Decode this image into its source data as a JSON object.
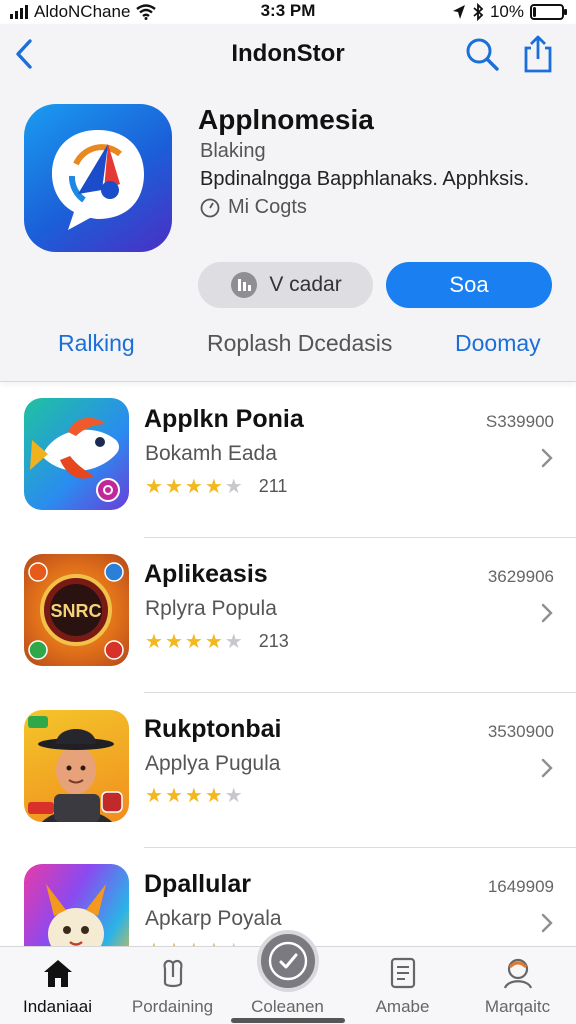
{
  "status_bar": {
    "carrier": "AldoNChane",
    "time": "3:3 PM",
    "battery": "10%",
    "battery_fraction": 0.1
  },
  "nav": {
    "title": "IndonStor"
  },
  "app": {
    "name": "Applnomesia",
    "category": "Blaking",
    "description": "Bpdinalngga Bapphlanaks.  Apphksis.",
    "rating_text": "Mi Cogts",
    "secondary_button": "V cadar",
    "primary_button": "Soa"
  },
  "tabs": [
    "Ralking",
    "Roplash Dcedasis",
    "Doomay"
  ],
  "list": [
    {
      "title": "Applkn Ponia",
      "subtitle": "Bokamh Eada",
      "size": "S339900",
      "rating": 4.5,
      "count": "211"
    },
    {
      "title": "Aplikeasis",
      "subtitle": "Rplyra Popula",
      "size": "3629906",
      "rating": 4.5,
      "count": "213"
    },
    {
      "title": "Rukptonbai",
      "subtitle": "Applya Pugula",
      "size": "3530900",
      "rating": 4.5,
      "count": ""
    },
    {
      "title": "Dpallular",
      "subtitle": "Apkarp Poyala",
      "size": "1649909",
      "rating": 4,
      "count": ""
    }
  ],
  "game_badge_text": "SNRC",
  "tab_bar": {
    "items": [
      "Indaniaai",
      "Pordaining",
      "Coleanen",
      "Amabe",
      "Marqaitc"
    ]
  }
}
